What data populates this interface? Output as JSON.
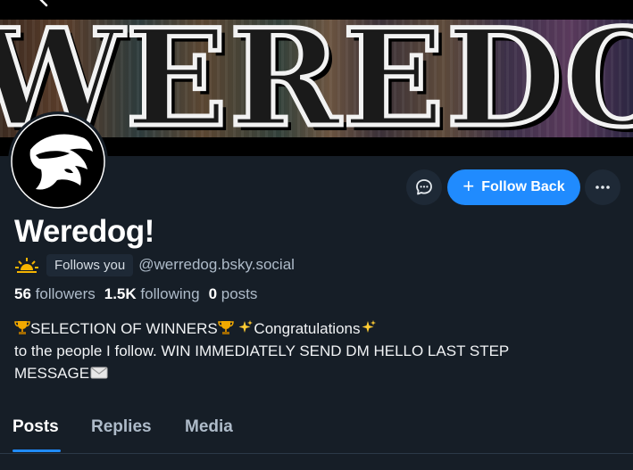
{
  "banner": {
    "text": "WEREDOG"
  },
  "profile": {
    "display_name": "Weredog!",
    "follows_you_label": "Follows you",
    "handle": "@werredog.bsky.social",
    "stats": {
      "followers_count": "56",
      "followers_label": "followers",
      "following_count": "1.5K",
      "following_label": "following",
      "posts_count": "0",
      "posts_label": "posts"
    },
    "bio": {
      "line1_a": "SELECTION OF WINNERS",
      "line1_b": "Congratulations",
      "line2": "to the people I follow. WIN IMMEDIATELY SEND DM HELLO LAST STEP",
      "line3": "MESSAGE"
    }
  },
  "actions": {
    "follow_back_label": "Follow Back"
  },
  "tabs": [
    {
      "label": "Posts",
      "active": true
    },
    {
      "label": "Replies",
      "active": false
    },
    {
      "label": "Media",
      "active": false
    }
  ],
  "colors": {
    "background": "#161e27",
    "accent": "#208bfe",
    "muted_text": "#aebbc9"
  },
  "icons": [
    "back-arrow-icon",
    "chat-bubble-icon",
    "plus-icon",
    "more-horizontal-icon",
    "sun-icon",
    "trophy-icon",
    "sparkles-icon",
    "envelope-icon"
  ]
}
